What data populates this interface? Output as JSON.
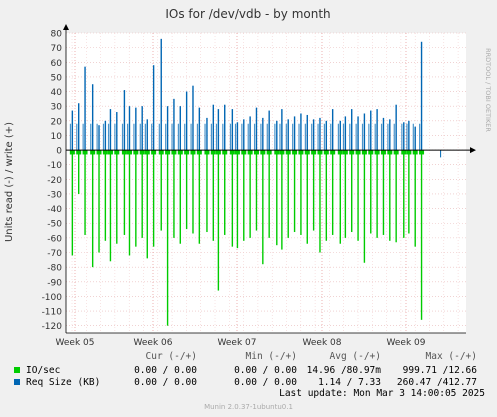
{
  "chart_data": {
    "type": "bar",
    "title": "IOs for /dev/vdb - by month",
    "ylabel": "Units read (-) / write (+)",
    "side_label": "RRDTOOL / TOBI OETIKER",
    "ylim": [
      -125,
      80
    ],
    "yticks": [
      80,
      70,
      60,
      50,
      40,
      30,
      20,
      10,
      0,
      -10,
      -20,
      -30,
      -40,
      -50,
      -60,
      -70,
      -80,
      -90,
      -100,
      -110,
      -120
    ],
    "xticks": [
      "Week 05",
      "Week 06",
      "Week 07",
      "Week 08",
      "Week 09"
    ],
    "grid": true,
    "series": [
      {
        "name": "IO/sec",
        "color": "#00cc00",
        "x": [
          0.5,
          1.0,
          1.5,
          2.1,
          2.6,
          3.1,
          3.5,
          4.0,
          4.6,
          5.0,
          5.5,
          6.0,
          6.4,
          6.9,
          7.5,
          8.0,
          8.5,
          9.0,
          9.5,
          10.0,
          10.5,
          11.1,
          11.6,
          12.0,
          12.5,
          13.1,
          13.5,
          14.0,
          14.5,
          15.0,
          15.5,
          16.0,
          16.6,
          17.0,
          17.5,
          18.0,
          18.5,
          19.0,
          19.5,
          20.0,
          20.5,
          21.0,
          21.6,
          22.0,
          22.5,
          23.0,
          23.5,
          24.0,
          24.5,
          25.0,
          25.5,
          26.0,
          26.6,
          27.0,
          27.5,
          28.0
        ],
        "values": [
          -72,
          -30,
          -58,
          -80,
          -70,
          -62,
          -76,
          -64,
          -58,
          -72,
          -66,
          -60,
          -74,
          -66,
          -55,
          -120,
          -60,
          -64,
          -54,
          -57,
          -64,
          -56,
          -62,
          -96,
          -58,
          -66,
          -67,
          -62,
          -60,
          -55,
          -78,
          -60,
          -65,
          -68,
          -60,
          -56,
          -58,
          -64,
          -55,
          -70,
          -62,
          -58,
          -64,
          -60,
          -56,
          -62,
          -77,
          -57,
          -60,
          -58,
          -62,
          -63,
          -60,
          -57,
          -66,
          -116
        ]
      },
      {
        "name": "Req Size (KB)",
        "color": "#0066b3",
        "x": [
          0.5,
          1.0,
          1.5,
          2.1,
          2.6,
          3.1,
          3.5,
          4.0,
          4.6,
          5.0,
          5.5,
          6.0,
          6.4,
          6.9,
          7.5,
          8.0,
          8.5,
          9.0,
          9.5,
          10.0,
          10.5,
          11.1,
          11.6,
          12.0,
          12.5,
          13.1,
          13.5,
          14.0,
          14.5,
          15.0,
          15.5,
          16.0,
          16.6,
          17.0,
          17.5,
          18.0,
          18.5,
          19.0,
          19.5,
          20.0,
          20.5,
          21.0,
          21.6,
          22.0,
          22.5,
          23.0,
          23.5,
          24.0,
          24.5,
          25.0,
          25.5,
          26.0,
          26.6,
          27.0,
          27.5,
          28.0
        ],
        "values": [
          27,
          32,
          57,
          45,
          17,
          20,
          28,
          26,
          41,
          30,
          29,
          30,
          21,
          58,
          76,
          30,
          35,
          30,
          40,
          44,
          29,
          22,
          31,
          28,
          31,
          28,
          19,
          21,
          23,
          29,
          22,
          27,
          20,
          28,
          21,
          23,
          25,
          24,
          21,
          22,
          20,
          28,
          20,
          23,
          28,
          23,
          25,
          27,
          28,
          22,
          21,
          31,
          19,
          20,
          16,
          74
        ]
      }
    ],
    "xlim": [
      0,
      31.5
    ],
    "tail": {
      "x": 29.5,
      "value": -5
    }
  },
  "legend": {
    "headers": {
      "cur": "Cur (-/+)",
      "min": "Min (-/+)",
      "avg": "Avg (-/+)",
      "max": "Max (-/+)"
    },
    "rows": [
      {
        "label": "IO/sec",
        "color": "#00cc00",
        "cur": "0.00 / 0.00",
        "min": "0.00 / 0.00",
        "avg": "14.96 /80.97m",
        "max": "999.71 /12.66"
      },
      {
        "label": "Req Size (KB)",
        "color": "#0066b3",
        "cur": "0.00 / 0.00",
        "min": "0.00 / 0.00",
        "avg": "1.14 / 7.33",
        "max": "260.47 /412.77"
      }
    ],
    "last_update": "Last update: Mon Mar  3 14:00:05 2025"
  },
  "footer": "Munin 2.0.37-1ubuntu0.1"
}
